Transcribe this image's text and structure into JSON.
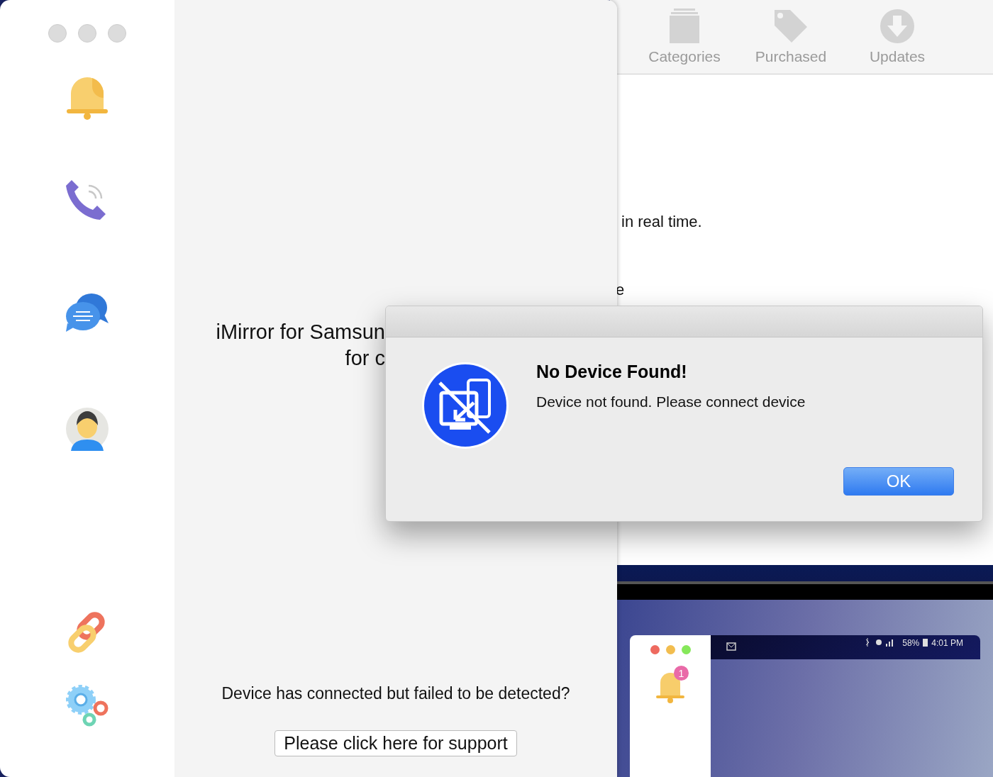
{
  "background_window": {
    "toolbar": [
      {
        "label": "Categories"
      },
      {
        "label": "Purchased"
      },
      {
        "label": "Updates"
      }
    ],
    "fragments": [
      "in real time.",
      "e"
    ]
  },
  "main_window": {
    "app_title": "iMirror for Samsun",
    "app_subtitle": "for c",
    "help_text": "Device has connected but failed to be detected?",
    "support_button": "Please click here for support"
  },
  "dialog": {
    "title": "No Device Found!",
    "message": "Device not found. Please connect device",
    "button": "OK"
  },
  "phone_mirror": {
    "badge": "1",
    "battery": "58%",
    "time": "4:01 PM"
  }
}
